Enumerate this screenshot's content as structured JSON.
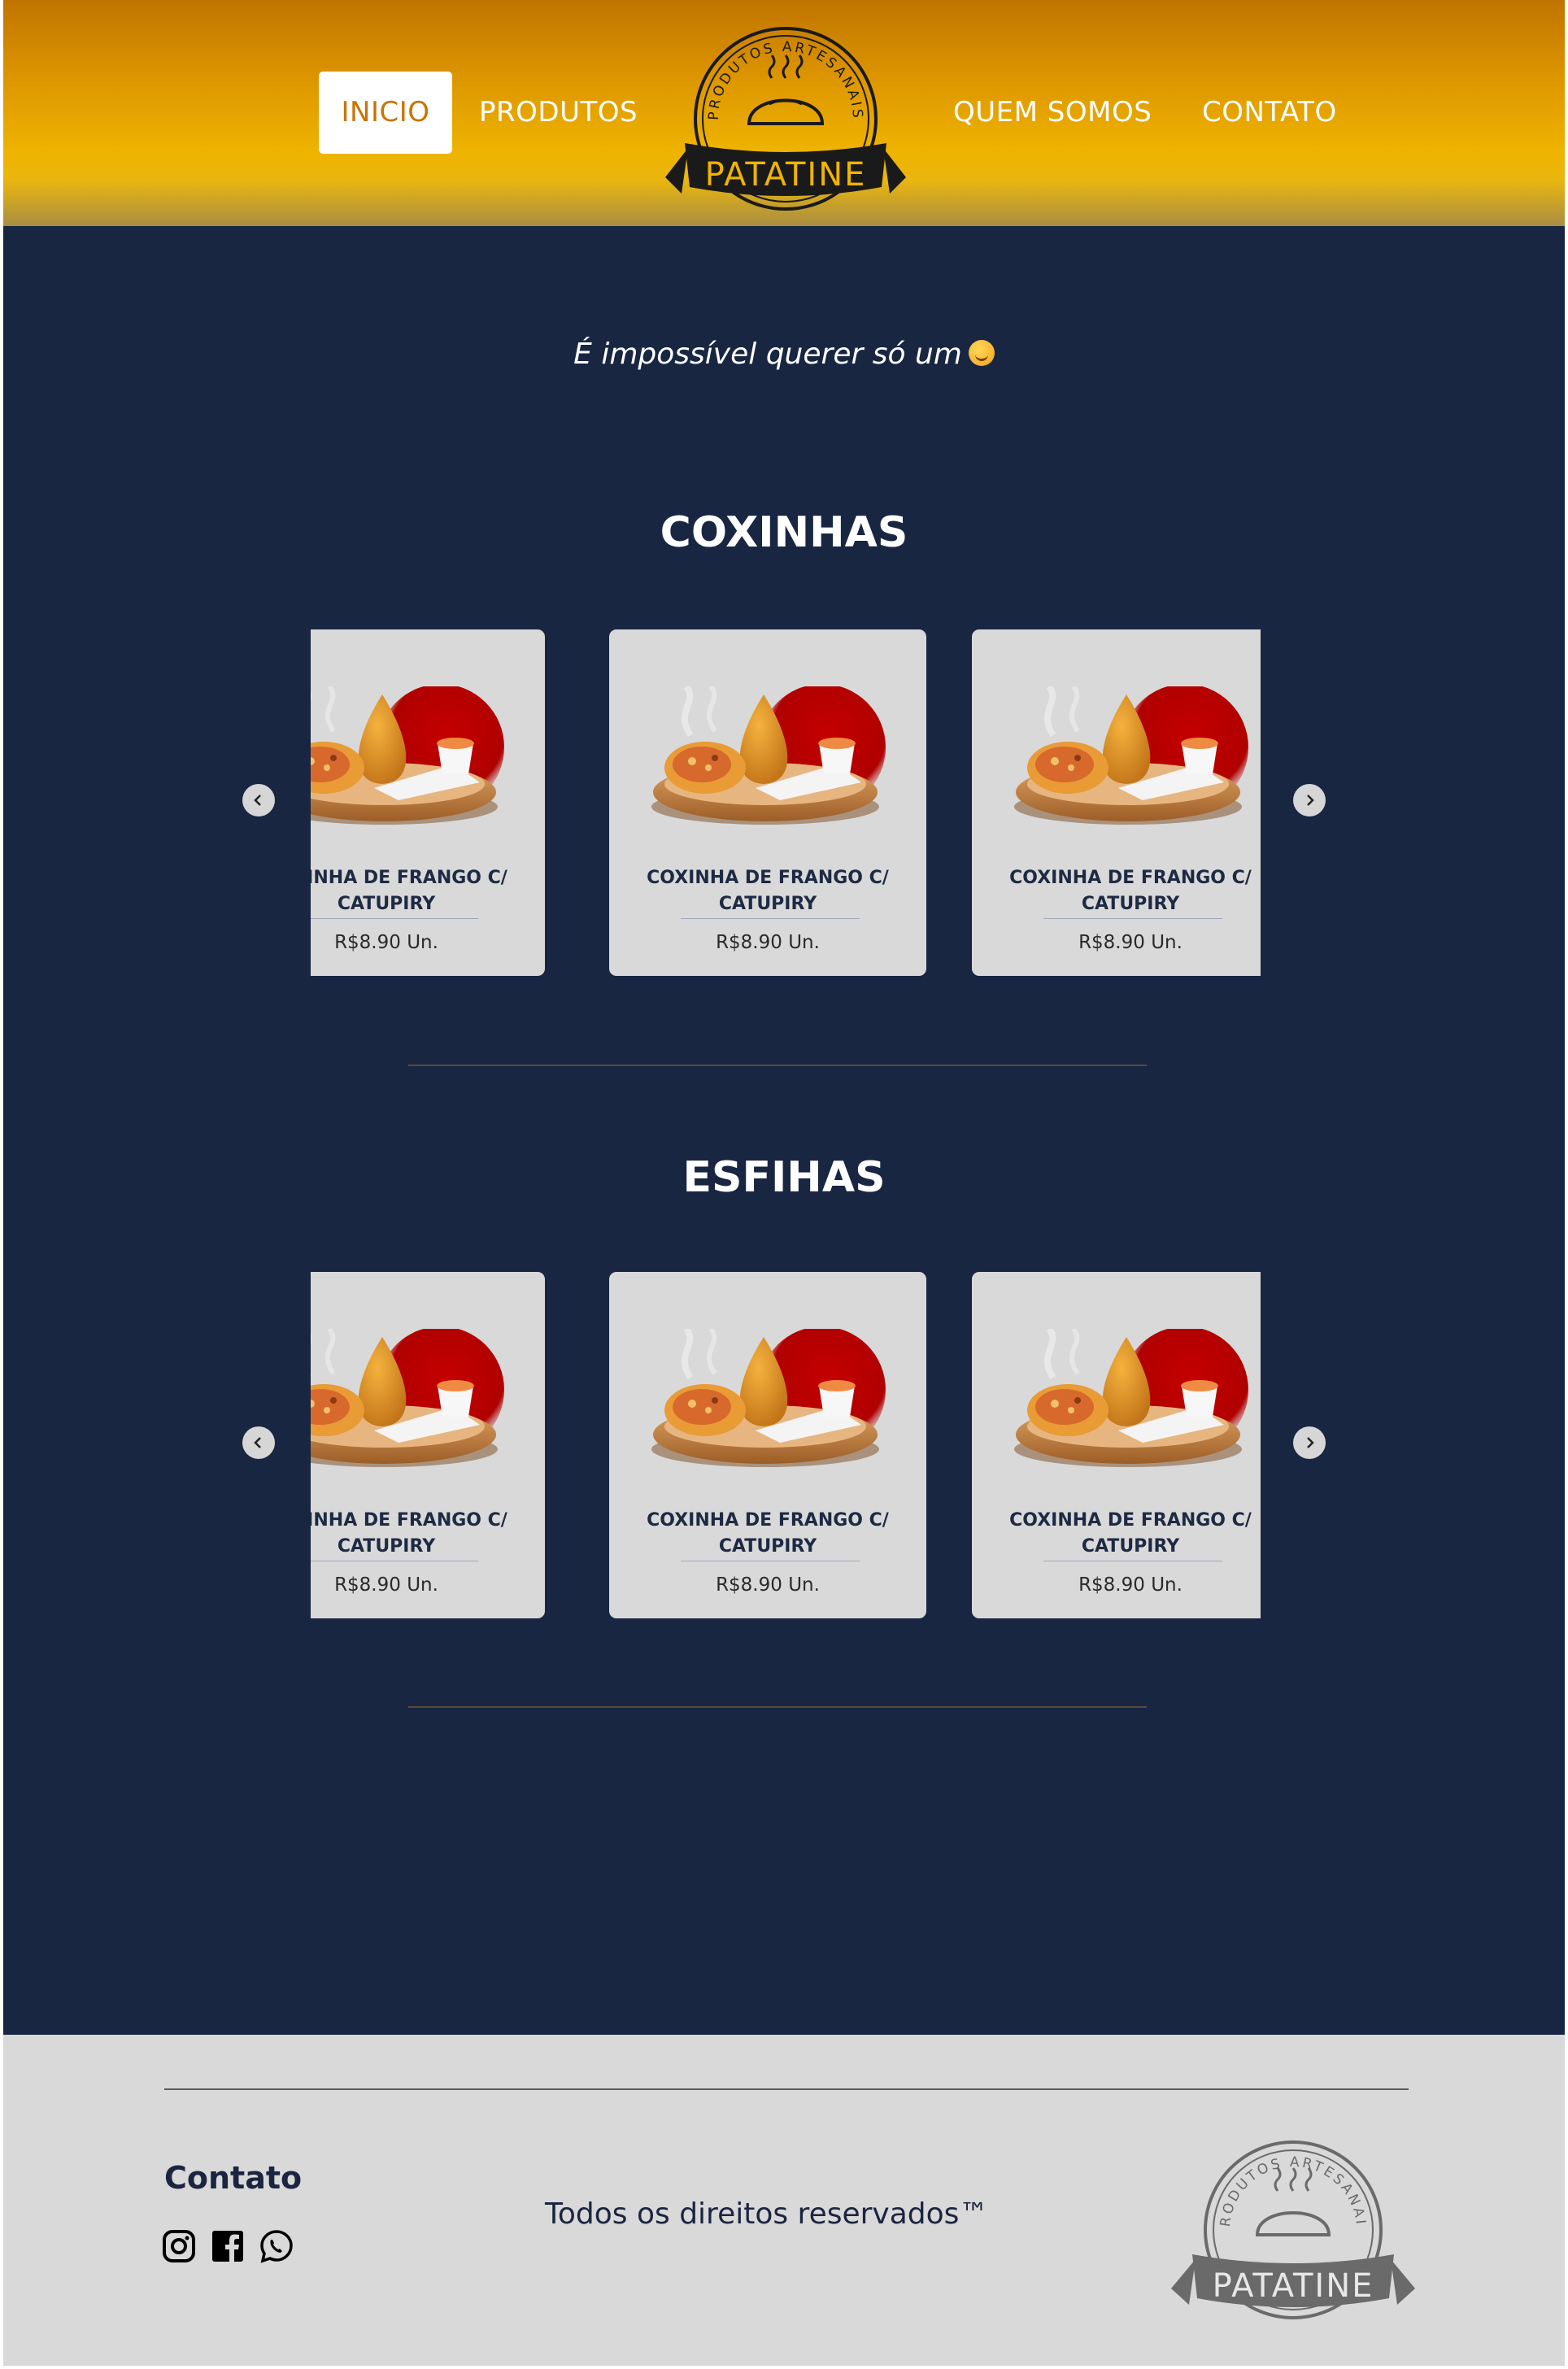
{
  "nav": {
    "items": [
      {
        "label": "INICIO",
        "active": true
      },
      {
        "label": "PRODUTOS",
        "active": false
      },
      {
        "label": "QUEM SOMOS",
        "active": false
      },
      {
        "label": "CONTATO",
        "active": false
      }
    ]
  },
  "logo": {
    "arc_text": "PRODUTOS ARTESANAIS",
    "brand": "PATATINE"
  },
  "colors": {
    "header_top": "#c07400",
    "header_mid": "#efb400",
    "main_bg": "#182642",
    "card_bg": "#d9d9d9",
    "footer_bg": "#d9d9d9",
    "active_nav_text": "#c97400"
  },
  "main": {
    "tagline": "É impossível querer só um",
    "sections": [
      {
        "title": "COXINHAS",
        "cards": [
          {
            "name_line1": "COXINHA DE FRANGO C/",
            "name_line2": "CATUPIRY",
            "price": "R$8.90 Un."
          },
          {
            "name_line1": "COXINHA DE FRANGO C/",
            "name_line2": "CATUPIRY",
            "price": "R$8.90 Un."
          },
          {
            "name_line1": "COXINHA DE FRANGO C/",
            "name_line2": "CATUPIRY",
            "price": "R$8.90 Un."
          }
        ]
      },
      {
        "title": "ESFIHAS",
        "cards": [
          {
            "name_line1": "COXINHA DE FRANGO C/",
            "name_line2": "CATUPIRY",
            "price": "R$8.90 Un."
          },
          {
            "name_line1": "COXINHA DE FRANGO C/",
            "name_line2": "CATUPIRY",
            "price": "R$8.90 Un."
          },
          {
            "name_line1": "COXINHA DE FRANGO C/",
            "name_line2": "CATUPIRY",
            "price": "R$8.90 Un."
          }
        ]
      }
    ]
  },
  "footer": {
    "heading": "Contato",
    "social_icons": [
      "instagram-icon",
      "facebook-icon",
      "whatsapp-icon"
    ],
    "copyright": "Todos os direitos reservados™"
  }
}
